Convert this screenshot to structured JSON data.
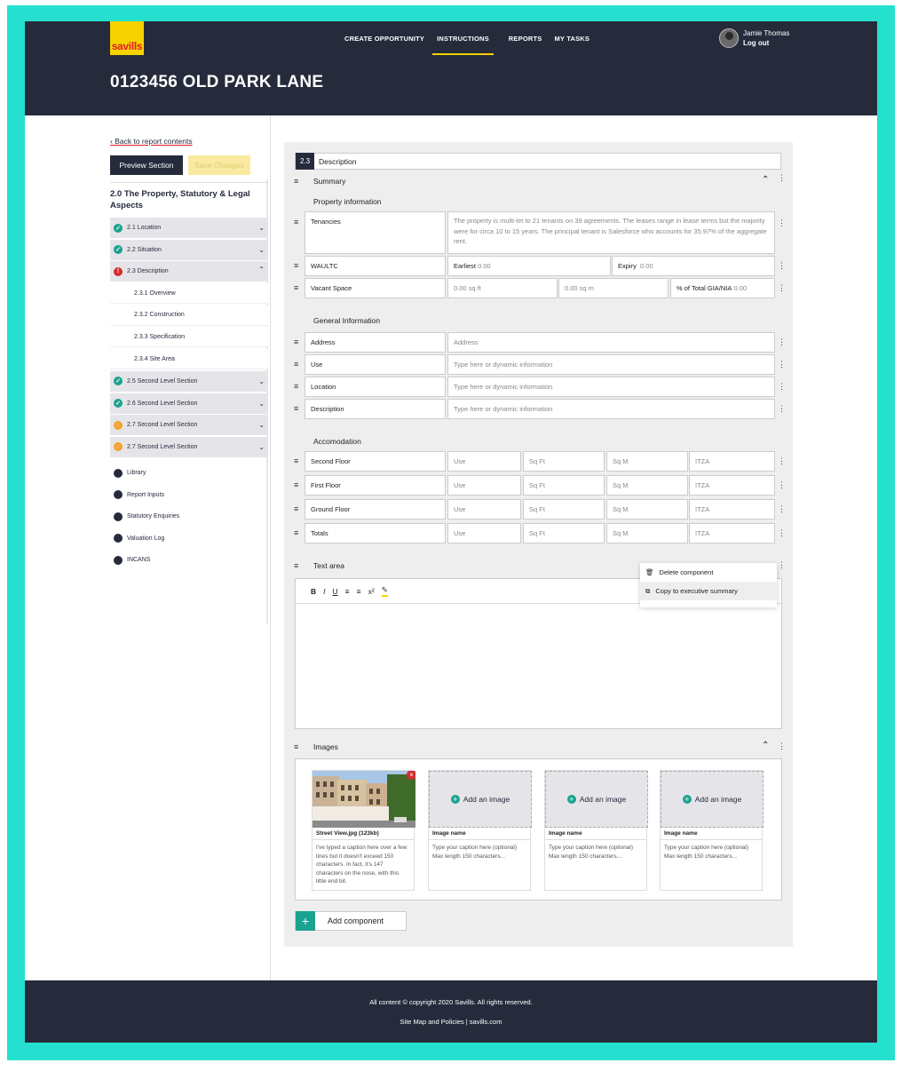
{
  "header": {
    "logo_text": "savills",
    "nav": [
      "CREATE OPPORTUNITY",
      "INSTRUCTIONS",
      "REPORTS",
      "MY TASKS"
    ],
    "active_nav": "INSTRUCTIONS",
    "user_name": "Jamie Thomas",
    "logout": "Log out",
    "page_title": "0123456 OLD PARK LANE"
  },
  "sidebar": {
    "back": "Back to report contents",
    "preview": "Preview Section",
    "save": "Save Changes",
    "section_title": "2.0 The Property, Statutory & Legal Aspects",
    "items": [
      {
        "label": "2.1 Location",
        "status": "ok",
        "icon": "check-icon"
      },
      {
        "label": "2.2 Situation",
        "status": "ok",
        "icon": "check-icon"
      },
      {
        "label": "2.3 Description",
        "status": "err",
        "icon": "alert-icon"
      },
      {
        "label": "2.5 Second Level Section",
        "status": "ok",
        "icon": "check-icon"
      },
      {
        "label": "2.6 Second Level Section",
        "status": "ok",
        "icon": "check-icon"
      },
      {
        "label": "2.7 Second Level Section",
        "status": "warn",
        "icon": "pending-icon"
      },
      {
        "label": "2.7 Second Level Section",
        "status": "warn",
        "icon": "pending-icon"
      }
    ],
    "subitems": [
      "2.3.1 Overview",
      "2.3.2 Construction",
      "2.3.3 Specification",
      "2.3.4 Site Area"
    ],
    "links": [
      {
        "label": "Library",
        "icon": "library-icon"
      },
      {
        "label": "Report Inputs",
        "icon": "link-icon"
      },
      {
        "label": "Statutory Enquiries",
        "icon": "search-icon"
      },
      {
        "label": "Valuation Log",
        "icon": "log-icon"
      },
      {
        "label": "INCANS",
        "icon": "chart-icon"
      }
    ]
  },
  "main": {
    "section_num": "2.3",
    "section_label": "Description",
    "summary": "Summary",
    "property_info": "Property information",
    "tenancies_label": "Tenancies",
    "tenancies_text": "The property is multi-let to 21 tenants on 39 agreements.  The leases range in lease terms but the majority were for circa 10 to 15 years.  The principal tenant is Salesforce who accounts for 35.97% of the aggregate rent.",
    "waultc": "WAULTC",
    "earliest_label": "Earliest",
    "earliest_value": "0.00",
    "expiry_label": "Expiry",
    "expiry_value": "0.00",
    "vacant_label": "Vacant Space",
    "vacant_sqft": "0.00 sq ft",
    "vacant_sqm": "0.00 sq m",
    "gia_label": "% of Total GIA/NIA",
    "gia_value": "0.00",
    "general_info": "General Information",
    "general_rows": [
      {
        "label": "Address",
        "value": "Address"
      },
      {
        "label": "Use",
        "value": "Type here or dynamic information"
      },
      {
        "label": "Location",
        "value": "Type here or dynamic information"
      },
      {
        "label": "Description",
        "value": "Type here or dynamic information"
      }
    ],
    "accommodation": "Accomodation",
    "accom_rows": [
      "Second Floor",
      "First Floor",
      "Ground Floor",
      "Totals"
    ],
    "accom_cols": [
      "Use",
      "Sq Ft",
      "Sq M",
      "ITZA"
    ],
    "text_area": "Text area",
    "toolbar": [
      "B",
      "I",
      "U",
      "≡",
      "≡",
      "x²",
      "✎"
    ],
    "menu": [
      "Delete component",
      "Copy to executive summary"
    ],
    "images": "Images",
    "image_cards": [
      {
        "name": "Street View.jpg (123kb)",
        "caption": "I've typed a caption here over a few lines but it doesn't exceed 150 characters. In fact, it's 147 characters on the nose, with this little end bit."
      },
      {
        "add": "Add an image",
        "name": "Image name",
        "caption": "Type your caption here (optional) Max length 150 characters..."
      },
      {
        "add": "Add an image",
        "name": "Image name",
        "caption": "Type your caption here (optional) Max length 150 characters..."
      },
      {
        "add": "Add an image",
        "name": "Image name",
        "caption": "Type your caption here (optional) Max length 150 characters..."
      }
    ],
    "add_component": "Add component"
  },
  "footer": {
    "copyright": "All content © copyright 2020 Savills. All rights reserved.",
    "links": "Site Map and Policies | savills.com"
  },
  "colors": {
    "navy": "#262b3c",
    "yellow": "#f5d200",
    "teal": "#1aa390",
    "frame": "#26e0cf",
    "red": "#d62b2b",
    "orange": "#f4a12d"
  }
}
